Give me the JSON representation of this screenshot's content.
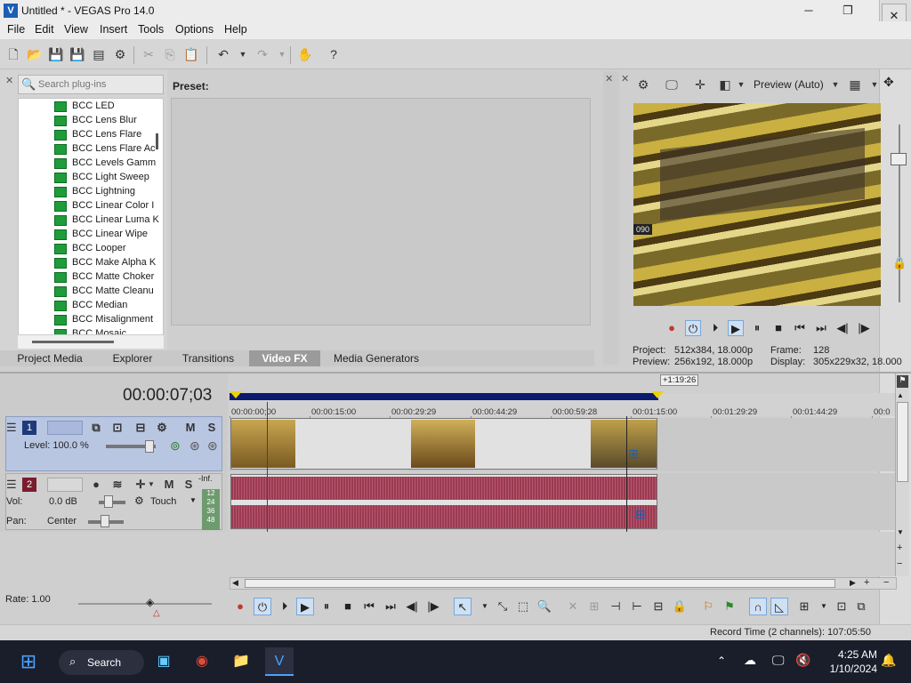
{
  "window": {
    "title": "Untitled * - VEGAS Pro 14.0",
    "minimize": "─",
    "maximize": "❐",
    "close": "✕"
  },
  "menu": [
    "File",
    "Edit",
    "View",
    "Insert",
    "Tools",
    "Options",
    "Help"
  ],
  "toolbar": {
    "icons": [
      "new-icon",
      "open-icon",
      "save-icon",
      "save-as-icon",
      "properties-icon",
      "cut-icon",
      "copy-icon",
      "paste-icon",
      "undo-icon",
      "redo-icon",
      "tool-icon",
      "help-icon"
    ]
  },
  "plugins": {
    "search_placeholder": "Search plug-ins",
    "items": [
      "BCC LED",
      "BCC Lens Blur",
      "BCC Lens Flare",
      "BCC Lens Flare Ac",
      "BCC Levels Gamm",
      "BCC Light Sweep",
      "BCC Lightning",
      "BCC Linear Color I",
      "BCC Linear Luma K",
      "BCC Linear Wipe",
      "BCC Looper",
      "BCC Make Alpha K",
      "BCC Matte Choker",
      "BCC Matte Cleanu",
      "BCC Median",
      "BCC Misalignment",
      "BCC Mosaic"
    ]
  },
  "preset": {
    "label": "Preset:"
  },
  "tabs": [
    {
      "label": "Project Media",
      "active": false
    },
    {
      "label": "Explorer",
      "active": false
    },
    {
      "label": "Transitions",
      "active": false
    },
    {
      "label": "Video FX",
      "active": true
    },
    {
      "label": "Media Generators",
      "active": false
    }
  ],
  "preview": {
    "quality": "Preview (Auto)",
    "overlay_text": "090",
    "project_label": "Project:",
    "project_value": "512x384, 18.000p",
    "preview_label": "Preview:",
    "preview_value": "256x192, 18.000p",
    "frame_label": "Frame:",
    "frame_value": "128",
    "display_label": "Display:",
    "display_value": "305x229x32, 18.000"
  },
  "timeline": {
    "timecode": "00:00:07;03",
    "loop_length": "+1:19:26",
    "ruler_labels": [
      "00:00:00;00",
      "00:00:15:00",
      "00:00:29:29",
      "00:00:44:29",
      "00:00:59:28",
      "00:01:15:00",
      "00:01:29:29",
      "00:01:44:29",
      "00:0"
    ]
  },
  "tracks": {
    "video": {
      "number": "1",
      "level_label": "Level: 100.0 %",
      "mute": "M",
      "solo": "S"
    },
    "audio": {
      "number": "2",
      "vol_label": "Vol:",
      "vol_value": "0.0 dB",
      "pan_label": "Pan:",
      "pan_value": "Center",
      "automation": "Touch",
      "mute": "M",
      "solo": "S",
      "meter_labels": [
        "-Inf.",
        "12",
        "24",
        "36",
        "48"
      ]
    }
  },
  "bottom": {
    "rate": "Rate: 1.00"
  },
  "status": {
    "record_time": "Record Time (2 channels): 107:05:50"
  },
  "taskbar": {
    "search_label": "Search",
    "time": "4:25 AM",
    "date": "1/10/2024"
  },
  "colors": {
    "accent": "#1a5fb4",
    "audio_wave": "#9c3a52",
    "loop_region": "#0a1a6e",
    "taskbar": "#1a1d2a"
  }
}
